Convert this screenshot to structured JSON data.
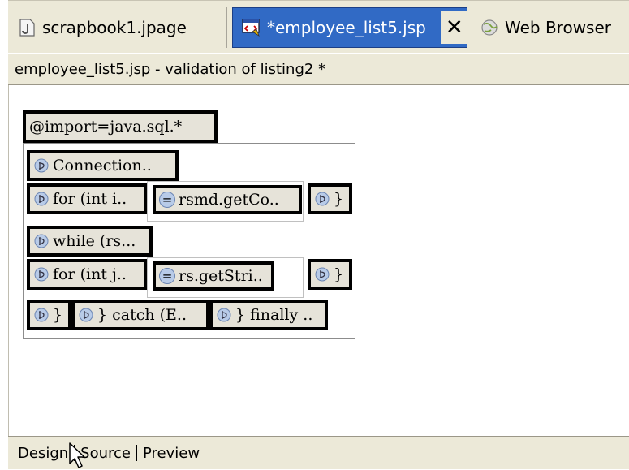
{
  "editor_tabs": [
    {
      "label": "scrapbook1.jpage",
      "icon": "java-scrapbook-icon",
      "active": false
    },
    {
      "label": "*employee_list5.jsp",
      "icon": "jsp-file-icon",
      "active": true,
      "close_glyph": "✕"
    },
    {
      "label": "Web Browser",
      "icon": "web-browser-globe-icon",
      "active": false
    }
  ],
  "description": "employee_list5.jsp - validation of listing2 *",
  "design": {
    "directive": "@import=java.sql.*",
    "scriptlets": {
      "connection": "Connection..",
      "for_i": "for (int i..",
      "expr_rsmd": "rsmd.getCo..",
      "close_1": "}",
      "while_rs": "while (rs...",
      "for_j": "for (int j..",
      "expr_rs": "rs.getStri..",
      "close_2": "}",
      "close_3": "}",
      "catch": "} catch (E..",
      "finally": "} finally .."
    },
    "expr_glyph": "="
  },
  "bottom_tabs": [
    "Design",
    "Source",
    "Preview"
  ],
  "colors": {
    "active_tab": "#316ac5",
    "chrome": "#ece9d8",
    "block_fill": "#e6e3d9"
  }
}
